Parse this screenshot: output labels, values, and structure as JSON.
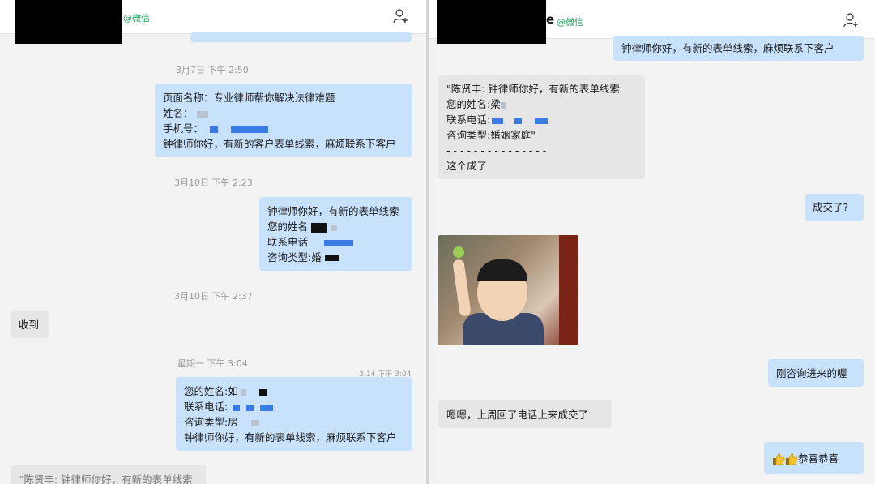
{
  "left": {
    "header": {
      "wechat_tag": "@微信"
    },
    "messages": {
      "ts1": "3月7日 下午 2:50",
      "m1": {
        "line1": "页面名称：专业律师帮你解决法律难题",
        "line2": "姓名：",
        "line3": "手机号：",
        "line4": "钟律师你好，有新的客户表单线索，麻烦联系下客户"
      },
      "ts2": "3月10日 下午 2:23",
      "m2": {
        "line1": "钟律师你好，有新的表单线索",
        "line2": "您的姓名",
        "line3": "联系电话",
        "line4": "咨询类型:婚"
      },
      "ts3": "3月10日 下午 2:37",
      "m3": "收到",
      "ts4": "星期一 下午 3:04",
      "ts4_small": "3-14 下午 3:04",
      "m4": {
        "line1": "您的姓名:如",
        "line2": "联系电话:",
        "line3": "咨询类型:房",
        "line4": "钟律师你好，有新的表单线索，麻烦联系下客户"
      },
      "m5": "“陈贤丰: 钟律师你好，有新的表单线索"
    }
  },
  "right": {
    "header": {
      "name_tail": "e",
      "wechat_tag": "@微信"
    },
    "messages": {
      "m1": "钟律师你好，有新的表单线索，麻烦联系下客户",
      "m2": {
        "line1": "\"陈贤丰: 钟律师你好，有新的表单线索",
        "line2": "您的姓名:梁",
        "line3": "联系电话:",
        "line4": "咨询类型:婚姻家庭\"",
        "line5": "- - - - - - - - - - - - - - -",
        "line6": "这个成了"
      },
      "m3": "成交了?",
      "m4": "刚咨询进来的喔",
      "m5": "嗯嗯，上周回了电话上来成交了",
      "m6": "恭喜恭喜"
    }
  },
  "colors": {
    "outgoing_bubble": "#c9e2fb",
    "incoming_bubble": "#e6e6e6",
    "wechat_green": "#19a35a"
  },
  "icons": {
    "add_contact": "add-contact-icon",
    "thumbs_up": "thumbs-up-icon"
  }
}
